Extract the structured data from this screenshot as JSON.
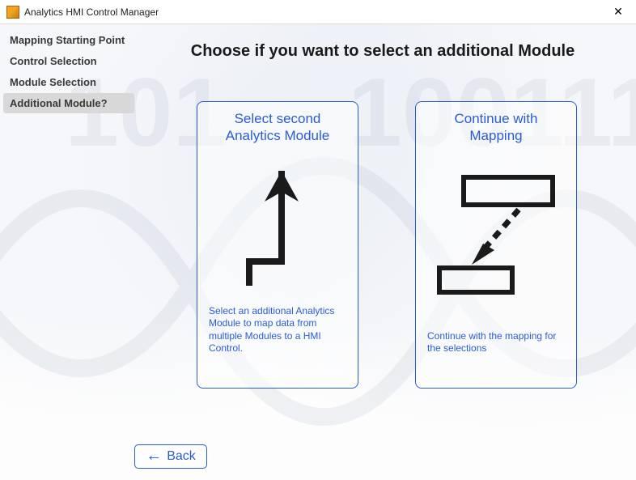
{
  "window": {
    "title": "Analytics HMI Control Manager"
  },
  "sidebar": {
    "items": [
      {
        "label": "Mapping Starting Point",
        "active": false
      },
      {
        "label": "Control Selection",
        "active": false
      },
      {
        "label": "Module Selection",
        "active": false
      },
      {
        "label": "Additional Module?",
        "active": true
      }
    ]
  },
  "page": {
    "heading": "Choose if you want to select an additional Module"
  },
  "cards": {
    "selectSecond": {
      "title": "Select second Analytics Module",
      "description": "Select an additional Analytics Module to map data from multiple Modules to a HMI Control."
    },
    "continueMapping": {
      "title": "Continue with Mapping",
      "description": "Continue with the mapping for the selections"
    }
  },
  "buttons": {
    "back": "Back"
  }
}
